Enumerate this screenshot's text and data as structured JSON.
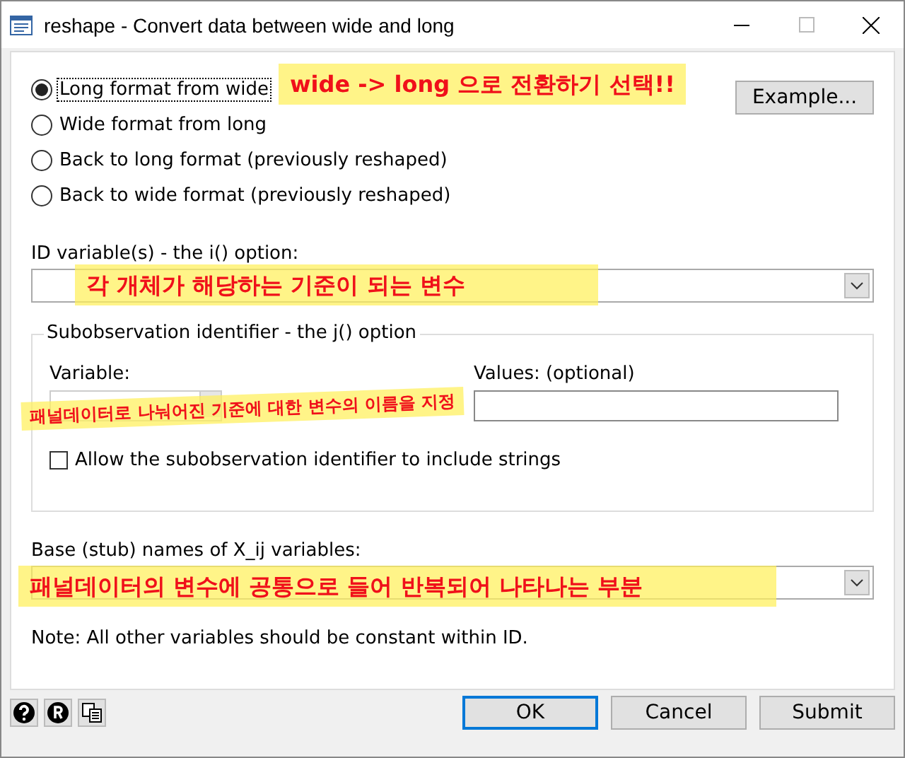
{
  "window": {
    "title": "reshape - Convert data between wide and long"
  },
  "formats": [
    {
      "label": "Long format from wide",
      "selected": true
    },
    {
      "label": "Wide format from long",
      "selected": false
    },
    {
      "label": "Back to long format (previously reshaped)",
      "selected": false
    },
    {
      "label": "Back to wide format (previously reshaped)",
      "selected": false
    }
  ],
  "example_button": "Example...",
  "id_field": {
    "label": "ID variable(s) - the i() option:"
  },
  "subobservation": {
    "title": "Subobservation identifier - the j() option",
    "variable_label": "Variable:",
    "values_label": "Values: (optional)",
    "allow_strings": {
      "label": "Allow the subobservation identifier to include strings",
      "checked": false
    }
  },
  "stub_field": {
    "label": "Base (stub) names of X_ij variables:"
  },
  "note": "Note:  All other variables should be constant within ID.",
  "annotations": [
    {
      "text": "wide -> long 으로 전환하기  선택!!"
    },
    {
      "text": "각 개체가 해당하는 기준이 되는 변수"
    },
    {
      "text": "패널데이터로 나눠어진 기준에 대한 변수의 이름을 지정"
    },
    {
      "text": "패널데이터의 변수에 공통으로 들어 반복되어 나타나는 부분"
    }
  ],
  "buttons": [
    {
      "label": "OK",
      "default": true
    },
    {
      "label": "Cancel",
      "default": false
    },
    {
      "label": "Submit",
      "default": false
    }
  ]
}
